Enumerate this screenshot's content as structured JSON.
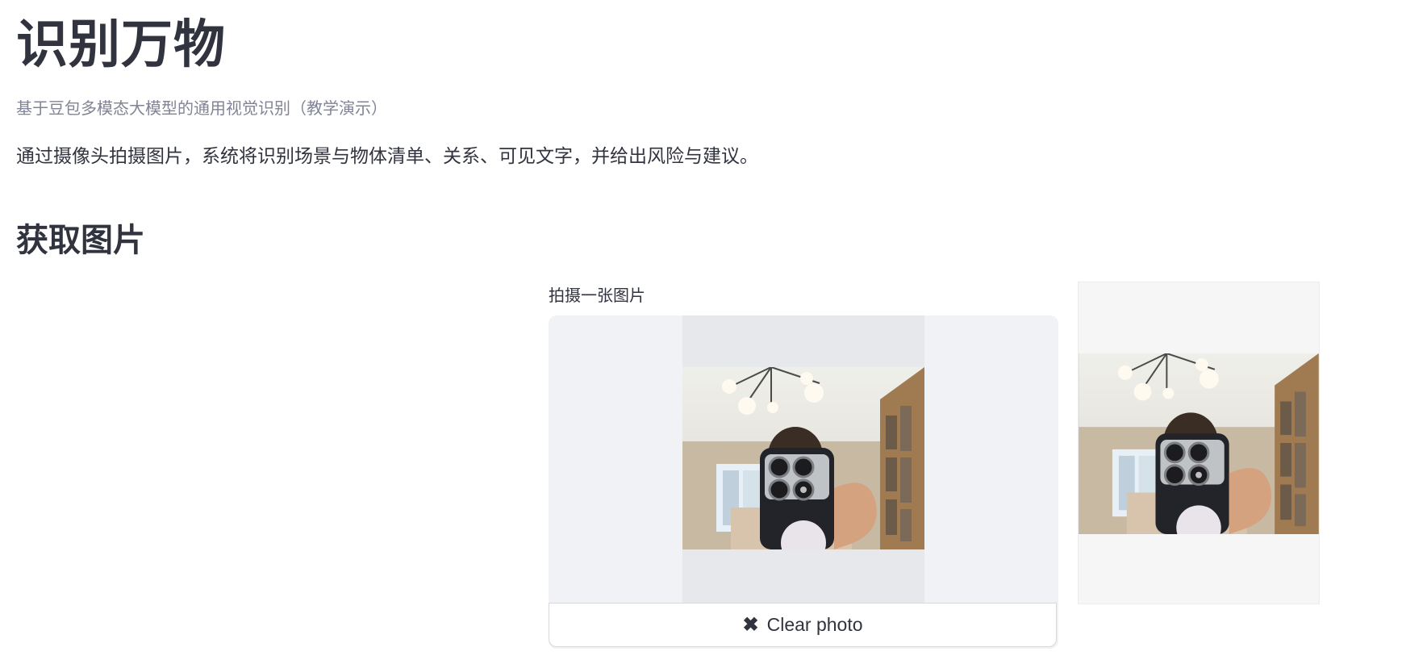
{
  "header": {
    "title": "识别万物",
    "subtitle": "基于豆包多模态大模型的通用视觉识别（教学演示）",
    "description": "通过摄像头拍摄图片，系统将识别场景与物体清单、关系、可见文字，并给出风险与建议。"
  },
  "section": {
    "heading": "获取图片"
  },
  "camera": {
    "label": "拍摄一张图片",
    "clear_button_label": "Clear photo",
    "clear_icon": "close-icon"
  },
  "colors": {
    "text": "#31333f",
    "muted_text": "#808495",
    "widget_background": "#f0f2f6",
    "preview_column_background": "#e6e8ec",
    "result_panel_background": "#f6f6f6"
  }
}
